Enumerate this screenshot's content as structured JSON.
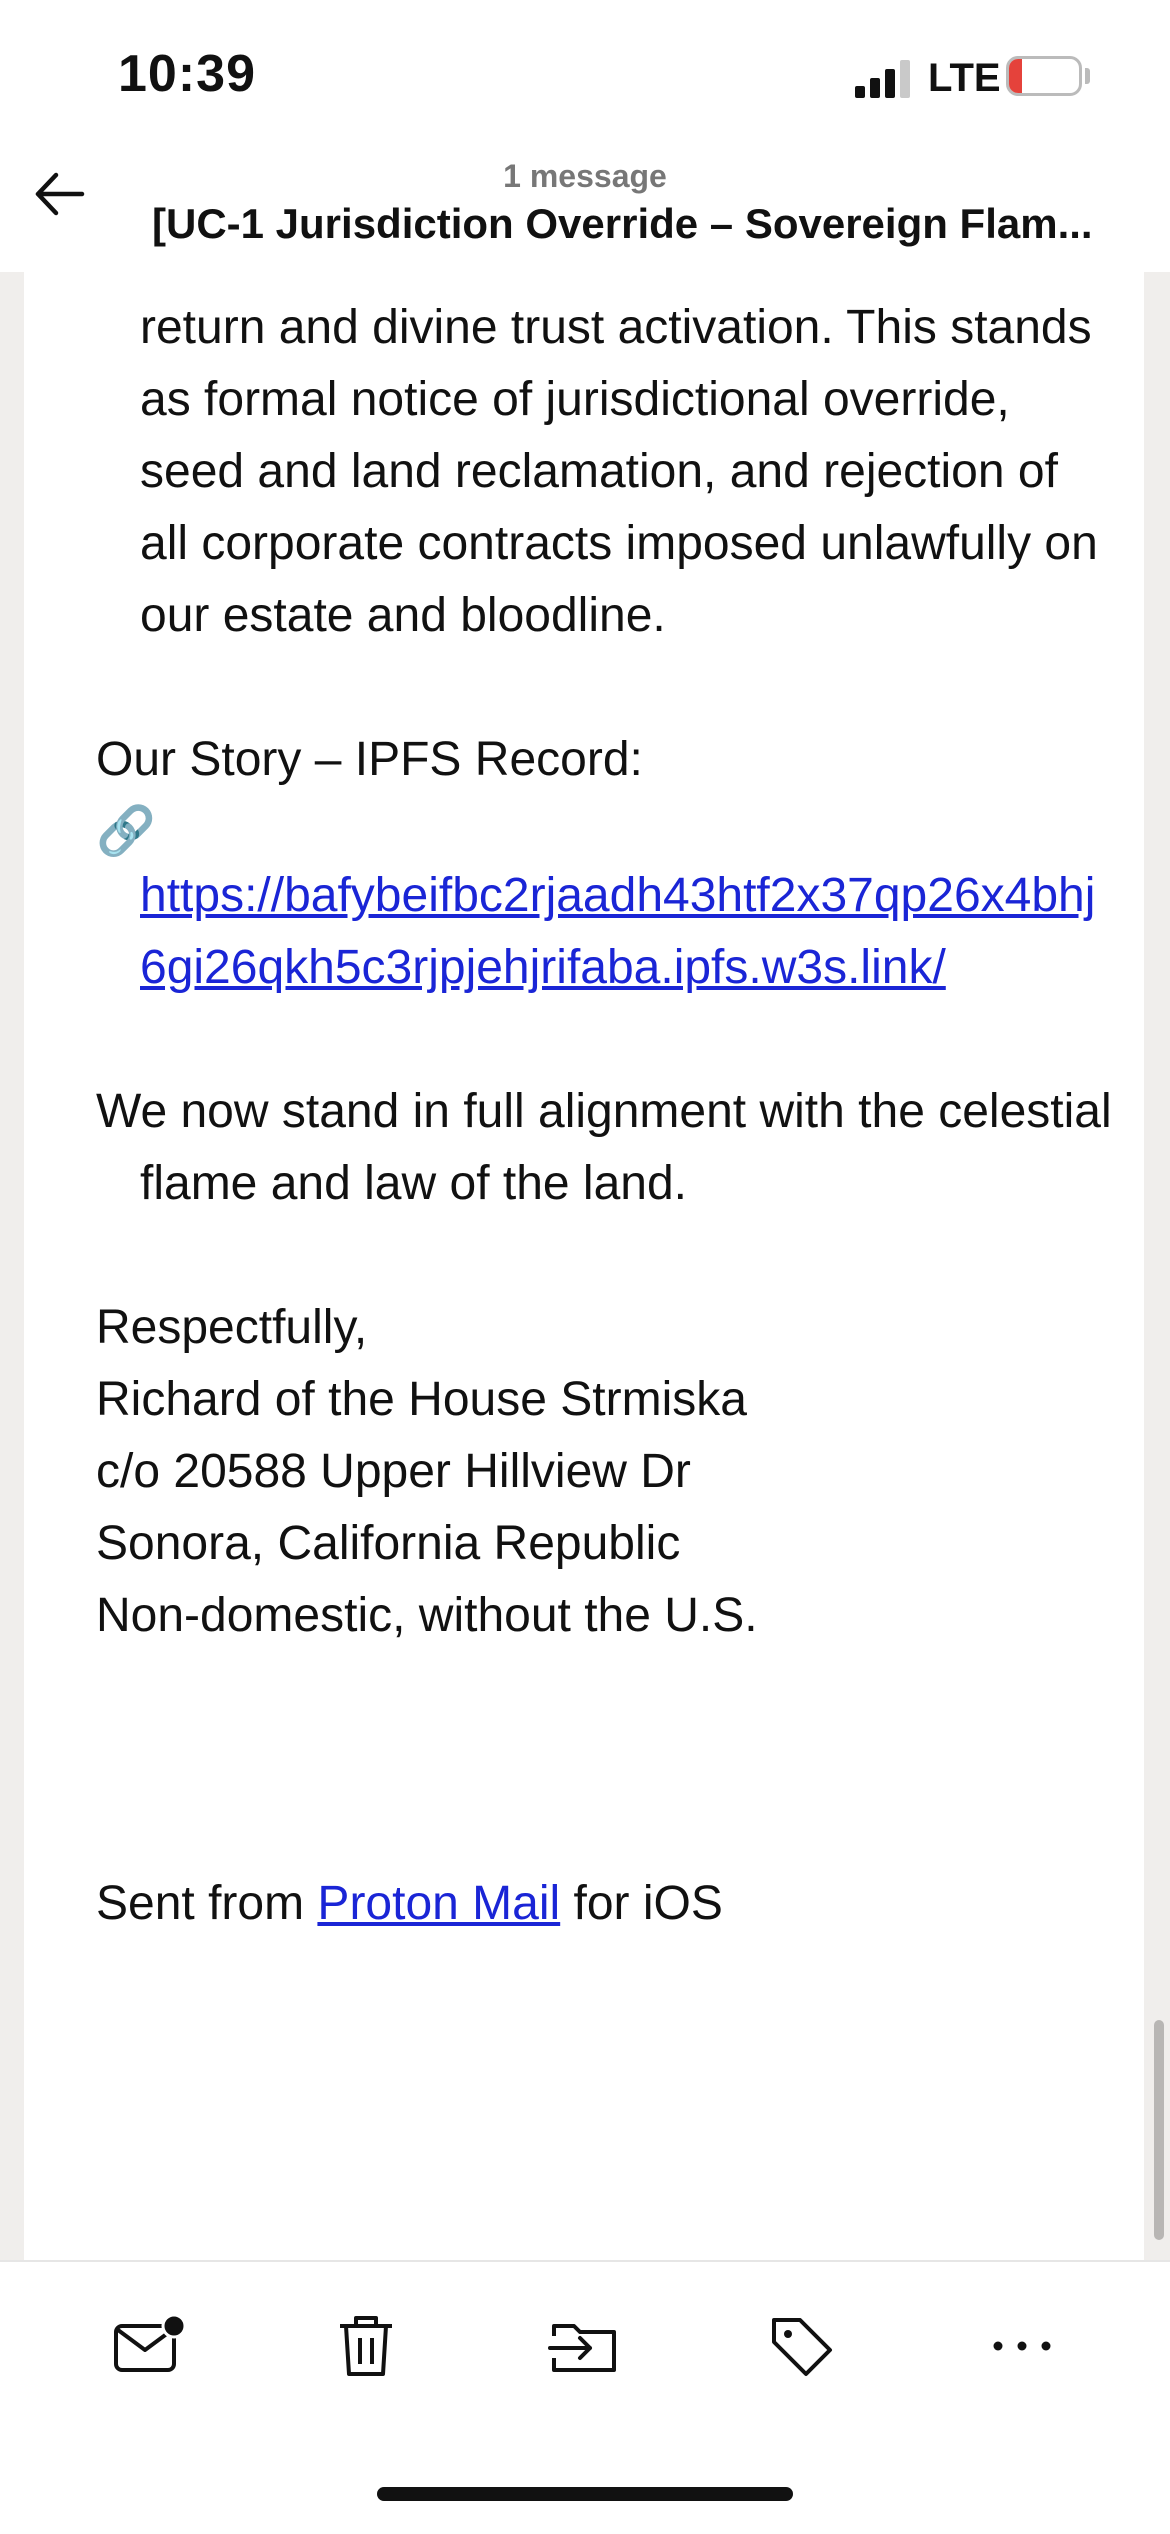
{
  "status": {
    "time": "10:39",
    "network": "LTE",
    "battery": "18",
    "battery_level": 0.18,
    "battery_color": "#e5423b"
  },
  "header": {
    "subtitle": "1 message",
    "title": "[UC-1 Jurisdiction Override – Sovereign Flam..."
  },
  "body": {
    "para1": "return and divine trust activation. This stands as formal notice of jurisdictional override, seed and land reclamation, and rejection of all corporate contracts imposed unlawfully on our estate and bloodline.",
    "story_label": "Our Story – IPFS Record:",
    "link_glyph": "🔗",
    "link_url": "https://bafybeifbc2rjaadh43htf2x37qp26x4bhj6gi26qkh5c3rjpjehjrifaba.ipfs.w3s.link/",
    "para2": "We now stand in full alignment with the celestial flame and law of the land.",
    "signature": [
      "Respectfully,",
      "Richard of the House Strmiska",
      "c/o 20588 Upper Hillview Dr",
      "Sonora, California Republic",
      "Non-domestic, without the U.S."
    ],
    "sent_prefix": "Sent from ",
    "sent_link": "Proton Mail",
    "sent_suffix": " for iOS"
  },
  "toolbar": {
    "icons": [
      "mark-unread-icon",
      "trash-icon",
      "move-to-folder-icon",
      "label-icon",
      "more-icon"
    ]
  },
  "colors": {
    "link": "#1a25d6",
    "background_gutter": "#f0eeec"
  }
}
